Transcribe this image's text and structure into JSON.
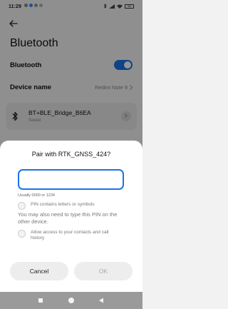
{
  "status_bar": {
    "time": "11:29",
    "battery": "88"
  },
  "settings": {
    "title": "Bluetooth",
    "bluetooth_label": "Bluetooth",
    "bluetooth_enabled": true,
    "device_name_label": "Device name",
    "device_name_value": "Redmi Note 9",
    "paired_device": {
      "name": "BT+BLE_Bridge_B6EA",
      "status": "Saved"
    }
  },
  "dialog": {
    "title": "Pair with RTK_GNSS_424?",
    "pin_value": "",
    "pin_hint": "Usually 0000 or 1234",
    "letters_option": "PIN contains letters or symbols",
    "pin_note": "You may also need to type this PIN on the other device.",
    "contacts_option": "Allow access to your contacts and call history",
    "cancel_label": "Cancel",
    "ok_label": "OK"
  },
  "colors": {
    "accent": "#1a73e8"
  }
}
